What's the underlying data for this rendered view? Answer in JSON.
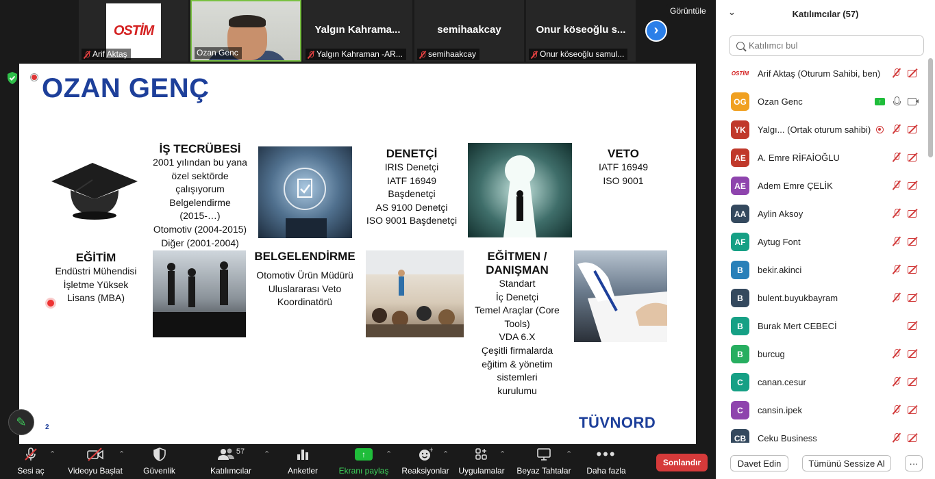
{
  "top_tiles": [
    {
      "name": "Arif Aktaş",
      "logo_text": "OSTİM",
      "muted": true
    },
    {
      "name": "Ozan Genc",
      "muted": false
    },
    {
      "name": "Yalgın Kahraman -AR...",
      "big": "Yalgın  Kahrama...",
      "muted": true
    },
    {
      "name": "semihaakcay",
      "big": "semihaakcay",
      "muted": true
    },
    {
      "name": "Onur köseoğlu samul...",
      "big": "Onur  köseoğlu  s...",
      "muted": true
    }
  ],
  "view_button": "Görüntüle",
  "slide": {
    "title": "OZAN GENÇ",
    "page_number": "2",
    "logo": "TÜVNORD",
    "egitim": {
      "heading": "EĞİTİM",
      "lines": [
        "Endüstri Mühendisi",
        "İşletme Yüksek",
        "Lisans (MBA)"
      ]
    },
    "is_tecrubesi": {
      "heading": "İŞ TECRÜBESİ",
      "lines": [
        "2001 yılından bu yana",
        "özel sektörde",
        "çalışıyorum",
        "Belgelendirme",
        "(2015-…)",
        "Otomotiv  (2004-2015)",
        "Diğer (2001-2004)"
      ]
    },
    "belgelendirme": {
      "heading": "BELGELENDİRME",
      "lines": [
        "Otomotiv Ürün Müdürü",
        "Uluslararası Veto",
        "Koordinatörü"
      ]
    },
    "denetci": {
      "heading": "DENETÇİ",
      "lines": [
        "IRIS Denetçi",
        "IATF 16949",
        "Başdenetçi",
        "AS 9100 Denetçi",
        "ISO 9001 Başdenetçi"
      ]
    },
    "veto": {
      "heading": "VETO",
      "lines": [
        "IATF 16949",
        "ISO 9001"
      ]
    },
    "egitmen": {
      "heading_1": "EĞİTMEN /",
      "heading_2": "DANIŞMAN",
      "lines": [
        "Standart",
        "İç Denetçi",
        "Temel Araçlar (Core",
        "Tools)",
        "VDA 6.X",
        "Çeşitli firmalarda",
        "eğitim & yönetim",
        "sistemleri",
        "kurulumu"
      ]
    }
  },
  "toolbar": {
    "mute": "Sesi aç",
    "video": "Videoyu Başlat",
    "security": "Güvenlik",
    "participants": "Katılımcılar",
    "participants_count": "57",
    "polls": "Anketler",
    "share": "Ekranı paylaş",
    "reactions": "Reaksiyonlar",
    "apps": "Uygulamalar",
    "whiteboards": "Beyaz Tahtalar",
    "more": "Daha fazla",
    "end": "Sonlandır"
  },
  "panel": {
    "title": "Katılımcılar (57)",
    "search_placeholder": "Katılımcı bul",
    "participants": [
      {
        "initials": "OSTİM",
        "name": "Arif Aktaş (Oturum Sahibi, ben)",
        "color": "#ffffff",
        "mic": "off",
        "cam": "off"
      },
      {
        "initials": "OG",
        "name": "Ozan Genc",
        "color": "#f0a020",
        "mic": "on",
        "cam": "on",
        "sharing": true
      },
      {
        "initials": "YK",
        "name": "Yalgı...  (Ortak oturum sahibi)",
        "color": "#c0392b",
        "mic": "off",
        "cam": "off",
        "recording": true
      },
      {
        "initials": "AE",
        "name": "A. Emre RİFAİOĞLU",
        "color": "#c0392b",
        "mic": "off",
        "cam": "off"
      },
      {
        "initials": "AE",
        "name": "Adem Emre ÇELİK",
        "color": "#8e44ad",
        "mic": "off",
        "cam": "off"
      },
      {
        "initials": "AA",
        "name": "Aylin Aksoy",
        "color": "#34495e",
        "mic": "off",
        "cam": "off"
      },
      {
        "initials": "AF",
        "name": "Aytug Font",
        "color": "#16a085",
        "mic": "off",
        "cam": "off"
      },
      {
        "initials": "B",
        "name": "bekir.akinci",
        "color": "#2980b9",
        "mic": "off",
        "cam": "off"
      },
      {
        "initials": "B",
        "name": "bulent.buyukbayram",
        "color": "#34495e",
        "mic": "off",
        "cam": "off"
      },
      {
        "initials": "B",
        "name": "Burak Mert CEBECİ",
        "color": "#16a085",
        "mic": "none",
        "cam": "off"
      },
      {
        "initials": "B",
        "name": "burcug",
        "color": "#27ae60",
        "mic": "off",
        "cam": "off"
      },
      {
        "initials": "C",
        "name": "canan.cesur",
        "color": "#16a085",
        "mic": "off",
        "cam": "off"
      },
      {
        "initials": "C",
        "name": "cansin.ipek",
        "color": "#8e44ad",
        "mic": "off",
        "cam": "off"
      },
      {
        "initials": "CB",
        "name": "Ceku Business",
        "color": "#34495e",
        "mic": "off",
        "cam": "off"
      }
    ],
    "invite": "Davet Edin",
    "mute_all": "Tümünü Sessize Al",
    "more": "···"
  }
}
